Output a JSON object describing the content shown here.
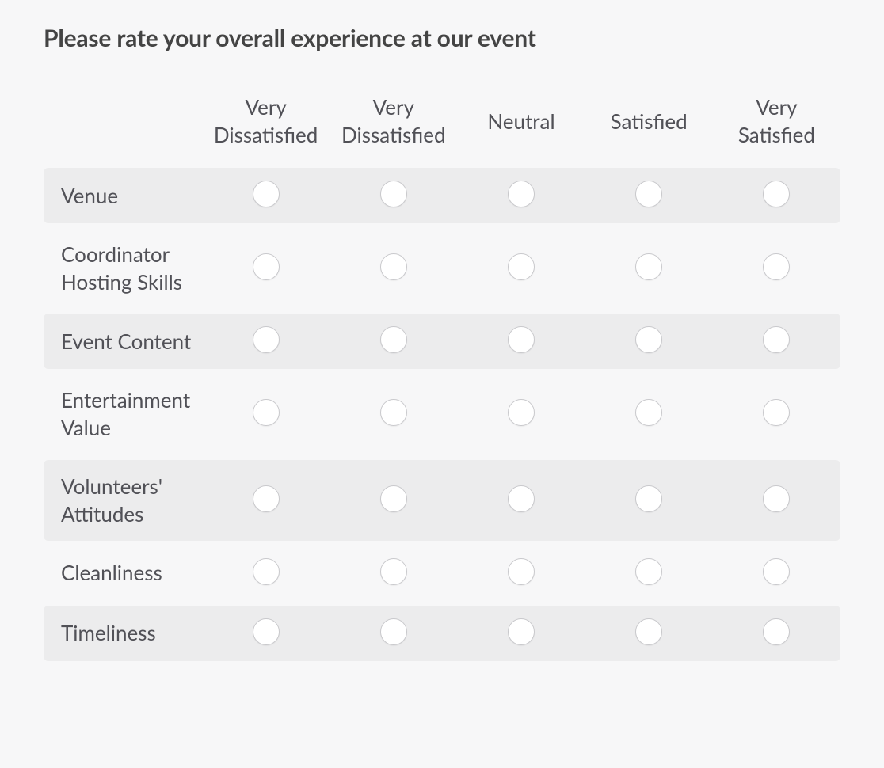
{
  "question": {
    "title": "Please rate your overall experience at our event",
    "columns": [
      "Very Dissatisfied",
      "Very Dissatisfied",
      "Neutral",
      "Satisfied",
      "Very Satisfied"
    ],
    "rows": [
      "Venue",
      "Coordinator Hosting Skills",
      "Event Content",
      "Entertainment Value",
      "Volunteers' Attitudes",
      "Cleanliness",
      "Timeliness"
    ]
  }
}
